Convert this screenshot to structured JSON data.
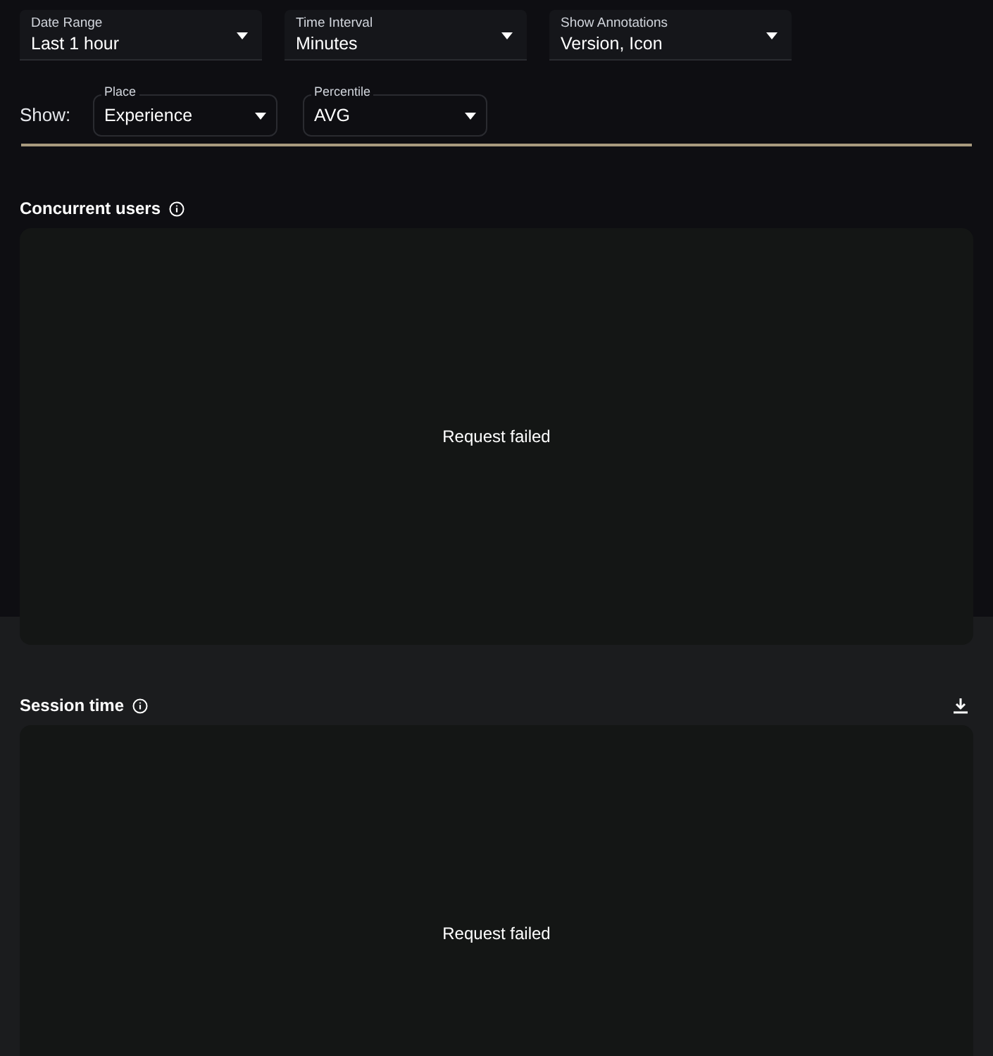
{
  "filters": [
    {
      "label": "Date Range",
      "value": "Last 1 hour"
    },
    {
      "label": "Time Interval",
      "value": "Minutes"
    },
    {
      "label": "Show Annotations",
      "value": "Version, Icon"
    }
  ],
  "show": {
    "label": "Show:",
    "selects": [
      {
        "label": "Place",
        "value": "Experience"
      },
      {
        "label": "Percentile",
        "value": "AVG"
      }
    ]
  },
  "charts": [
    {
      "title": "Concurrent users",
      "download": false,
      "message": "Request failed"
    },
    {
      "title": "Session time",
      "download": true,
      "message": "Request failed"
    }
  ]
}
